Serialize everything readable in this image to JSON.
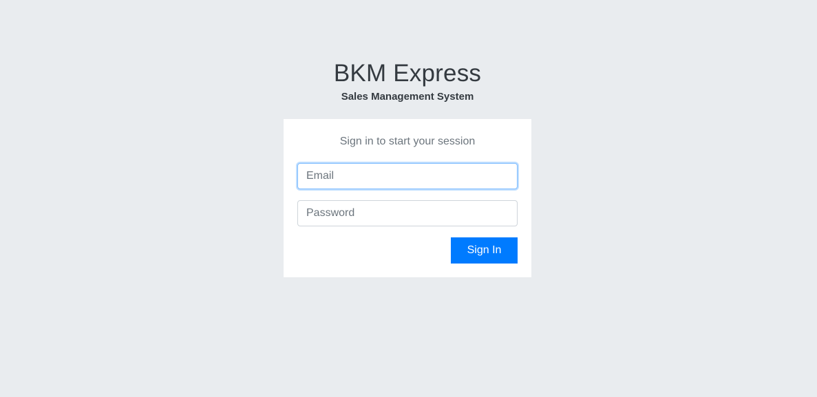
{
  "brand": {
    "title": "BKM Express",
    "subtitle": "Sales Management System"
  },
  "login": {
    "message": "Sign in to start your session",
    "email": {
      "placeholder": "Email",
      "value": ""
    },
    "password": {
      "placeholder": "Password",
      "value": ""
    },
    "submit_label": "Sign In"
  },
  "colors": {
    "background": "#e9ecef",
    "card": "#ffffff",
    "primary": "#007bff",
    "focus_border": "#80bdff"
  }
}
